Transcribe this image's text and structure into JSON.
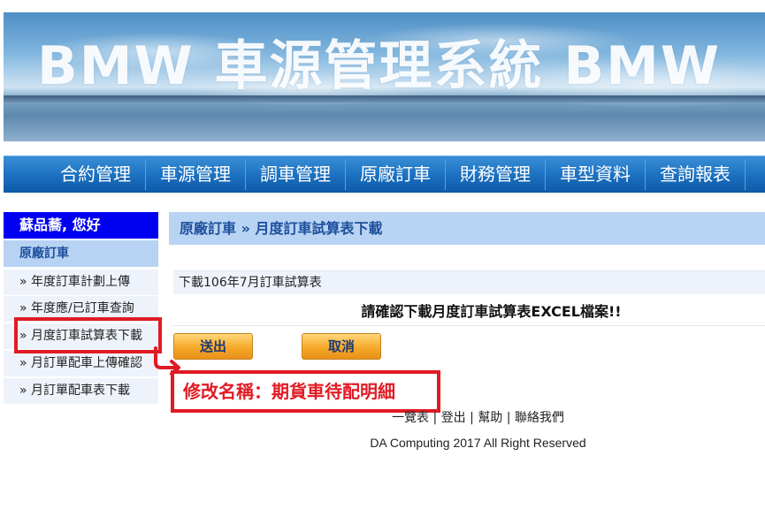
{
  "banner": {
    "title": "BMW 車源管理系統 BMW"
  },
  "nav": {
    "items": [
      "合約管理",
      "車源管理",
      "調車管理",
      "原廠訂車",
      "財務管理",
      "車型資料",
      "查詢報表"
    ]
  },
  "sidebar": {
    "greeting": "蘇品蕎, 您好",
    "section": "原廠訂車",
    "items": [
      "» 年度訂車計劃上傳",
      "» 年度應/已訂車查詢",
      "» 月度訂車試算表下載",
      "» 月訂單配車上傳確認",
      "» 月訂單配車表下載"
    ]
  },
  "main": {
    "breadcrumb": "原廠訂車 » 月度訂車試算表下載",
    "subheading": "下載106年7月訂車試算表",
    "confirm": "請確認下載月度訂車試算表EXCEL檔案!!",
    "submit_label": "送出",
    "cancel_label": "取消"
  },
  "annotation": {
    "text": "修改名稱：期貨車待配明細",
    "color": "#e01b24"
  },
  "footer": {
    "links": [
      "一覽表",
      "登出",
      "幫助",
      "聯絡我們"
    ],
    "separator": " | ",
    "copyright": "DA Computing 2017 All Right Reserved"
  },
  "colors": {
    "nav_bg": "#1b6fbf",
    "greeting_bg": "#0000f0",
    "section_bg": "#b7d2f2",
    "button_bg": "#f6a92a"
  }
}
